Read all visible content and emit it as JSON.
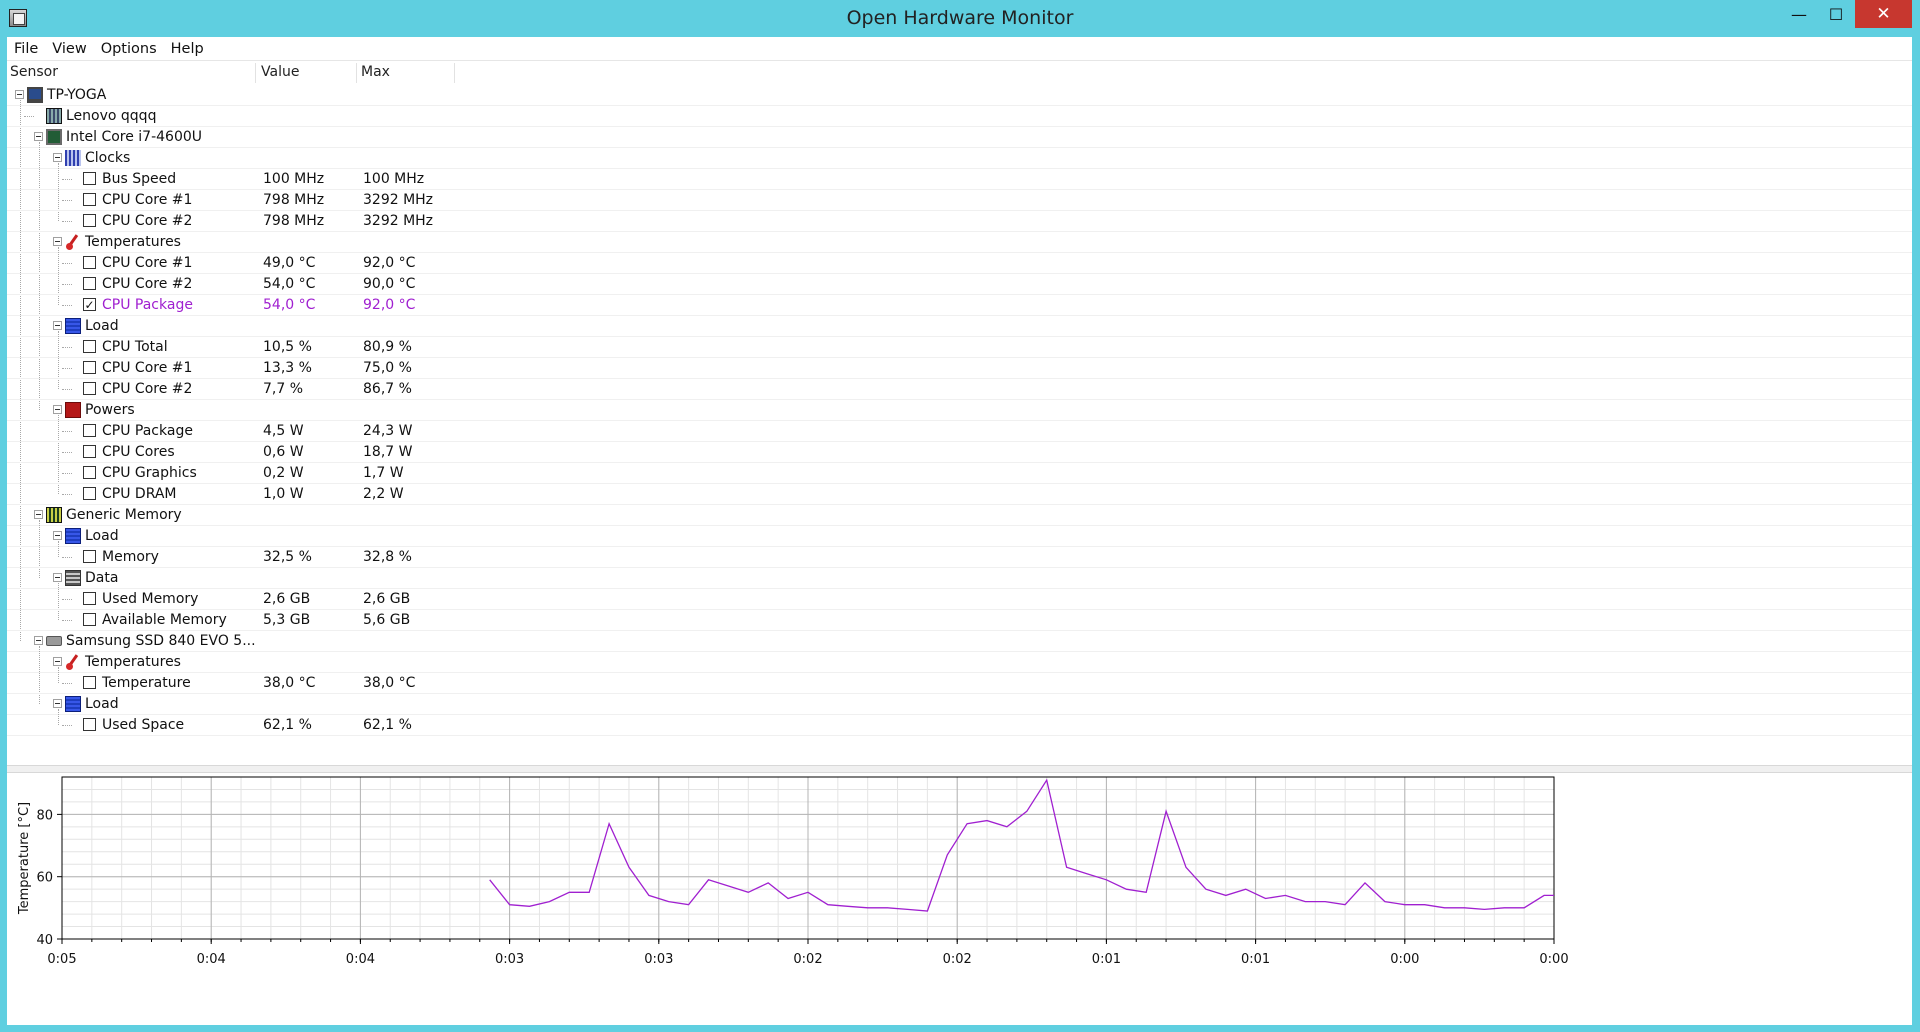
{
  "window": {
    "title": "Open Hardware Monitor",
    "minimize_glyph": "—",
    "maximize_glyph": "☐",
    "close_glyph": "✕"
  },
  "menu": [
    "File",
    "View",
    "Options",
    "Help"
  ],
  "columns": {
    "sensor": "Sensor",
    "value": "Value",
    "max": "Max"
  },
  "tree": [
    {
      "level": 0,
      "label": "TP-YOGA",
      "icon": "computer-icon",
      "kind": "node"
    },
    {
      "level": 1,
      "label": "Lenovo qqqq",
      "icon": "mainboard-icon",
      "kind": "leafnode"
    },
    {
      "level": 1,
      "label": "Intel Core i7-4600U",
      "icon": "cpu-icon",
      "kind": "node"
    },
    {
      "level": 2,
      "label": "Clocks",
      "icon": "clock-icon",
      "kind": "node"
    },
    {
      "level": 3,
      "label": "Bus Speed",
      "value": "100 MHz",
      "max": "100 MHz",
      "kind": "sensor",
      "checked": false
    },
    {
      "level": 3,
      "label": "CPU Core #1",
      "value": "798 MHz",
      "max": "3292 MHz",
      "kind": "sensor",
      "checked": false
    },
    {
      "level": 3,
      "label": "CPU Core #2",
      "value": "798 MHz",
      "max": "3292 MHz",
      "kind": "sensor",
      "checked": false
    },
    {
      "level": 2,
      "label": "Temperatures",
      "icon": "thermometer-icon",
      "kind": "node"
    },
    {
      "level": 3,
      "label": "CPU Core #1",
      "value": "49,0 °C",
      "max": "92,0 °C",
      "kind": "sensor",
      "checked": false
    },
    {
      "level": 3,
      "label": "CPU Core #2",
      "value": "54,0 °C",
      "max": "90,0 °C",
      "kind": "sensor",
      "checked": false
    },
    {
      "level": 3,
      "label": "CPU Package",
      "value": "54,0 °C",
      "max": "92,0 °C",
      "kind": "sensor",
      "checked": true
    },
    {
      "level": 2,
      "label": "Load",
      "icon": "load-icon",
      "kind": "node"
    },
    {
      "level": 3,
      "label": "CPU Total",
      "value": "10,5 %",
      "max": "80,9 %",
      "kind": "sensor",
      "checked": false
    },
    {
      "level": 3,
      "label": "CPU Core #1",
      "value": "13,3 %",
      "max": "75,0 %",
      "kind": "sensor",
      "checked": false
    },
    {
      "level": 3,
      "label": "CPU Core #2",
      "value": "7,7 %",
      "max": "86,7 %",
      "kind": "sensor",
      "checked": false
    },
    {
      "level": 2,
      "label": "Powers",
      "icon": "power-icon",
      "kind": "node"
    },
    {
      "level": 3,
      "label": "CPU Package",
      "value": "4,5 W",
      "max": "24,3 W",
      "kind": "sensor",
      "checked": false
    },
    {
      "level": 3,
      "label": "CPU Cores",
      "value": "0,6 W",
      "max": "18,7 W",
      "kind": "sensor",
      "checked": false
    },
    {
      "level": 3,
      "label": "CPU Graphics",
      "value": "0,2 W",
      "max": "1,7 W",
      "kind": "sensor",
      "checked": false
    },
    {
      "level": 3,
      "label": "CPU DRAM",
      "value": "1,0 W",
      "max": "2,2 W",
      "kind": "sensor",
      "checked": false
    },
    {
      "level": 1,
      "label": "Generic Memory",
      "icon": "memory-icon",
      "kind": "node"
    },
    {
      "level": 2,
      "label": "Load",
      "icon": "load-icon",
      "kind": "node"
    },
    {
      "level": 3,
      "label": "Memory",
      "value": "32,5 %",
      "max": "32,8 %",
      "kind": "sensor",
      "checked": false
    },
    {
      "level": 2,
      "label": "Data",
      "icon": "data-icon",
      "kind": "node"
    },
    {
      "level": 3,
      "label": "Used Memory",
      "value": "2,6 GB",
      "max": "2,6 GB",
      "kind": "sensor",
      "checked": false
    },
    {
      "level": 3,
      "label": "Available Memory",
      "value": "5,3 GB",
      "max": "5,6 GB",
      "kind": "sensor",
      "checked": false
    },
    {
      "level": 1,
      "label": "Samsung SSD 840 EVO 5...",
      "icon": "disk-icon",
      "kind": "node"
    },
    {
      "level": 2,
      "label": "Temperatures",
      "icon": "thermometer-icon",
      "kind": "node"
    },
    {
      "level": 3,
      "label": "Temperature",
      "value": "38,0 °C",
      "max": "38,0 °C",
      "kind": "sensor",
      "checked": false
    },
    {
      "level": 2,
      "label": "Load",
      "icon": "load-icon",
      "kind": "node"
    },
    {
      "level": 3,
      "label": "Used Space",
      "value": "62,1 %",
      "max": "62,1 %",
      "kind": "sensor",
      "checked": false
    }
  ],
  "colors": {
    "selected_sensor": "#a020d0",
    "plot_line": "#a020d0",
    "title_bar": "#5fcfe0",
    "close_button": "#c7372f"
  },
  "chart_data": {
    "type": "line",
    "ylabel": "Temperature [°C]",
    "ylim": [
      40,
      92
    ],
    "yticks": [
      "40",
      "60",
      "80"
    ],
    "xticks": [
      "0:05",
      "0:04",
      "0:04",
      "0:03",
      "0:03",
      "0:02",
      "0:02",
      "0:01",
      "0:01",
      "0:00",
      "0:00"
    ],
    "xlim_seconds_ago": [
      300,
      0
    ],
    "grid": true,
    "series": [
      {
        "color": "#a020d0",
        "x_seconds_ago": [
          214,
          210,
          206,
          202,
          198,
          194,
          190,
          186,
          182,
          178,
          174,
          170,
          166,
          162,
          158,
          154,
          150,
          146,
          142,
          138,
          134,
          130,
          126,
          122,
          118,
          114,
          110,
          106,
          102,
          98,
          94,
          90,
          86,
          82,
          78,
          74,
          70,
          66,
          62,
          58,
          54,
          50,
          46,
          42,
          38,
          34,
          30,
          26,
          22,
          18,
          14,
          10,
          6,
          2,
          0
        ],
        "values": [
          59,
          51,
          50.5,
          52,
          55,
          55,
          77,
          63,
          54,
          52,
          51,
          59,
          57,
          55,
          58,
          53,
          55,
          51,
          50.5,
          50,
          50,
          49.5,
          49,
          67,
          77,
          78,
          76,
          81,
          91,
          63,
          61,
          59,
          56,
          55,
          81,
          63,
          56,
          54,
          56,
          53,
          54,
          52,
          52,
          51,
          58,
          52,
          51,
          51,
          50,
          50,
          49.5,
          50,
          50,
          54,
          54
        ]
      }
    ]
  }
}
